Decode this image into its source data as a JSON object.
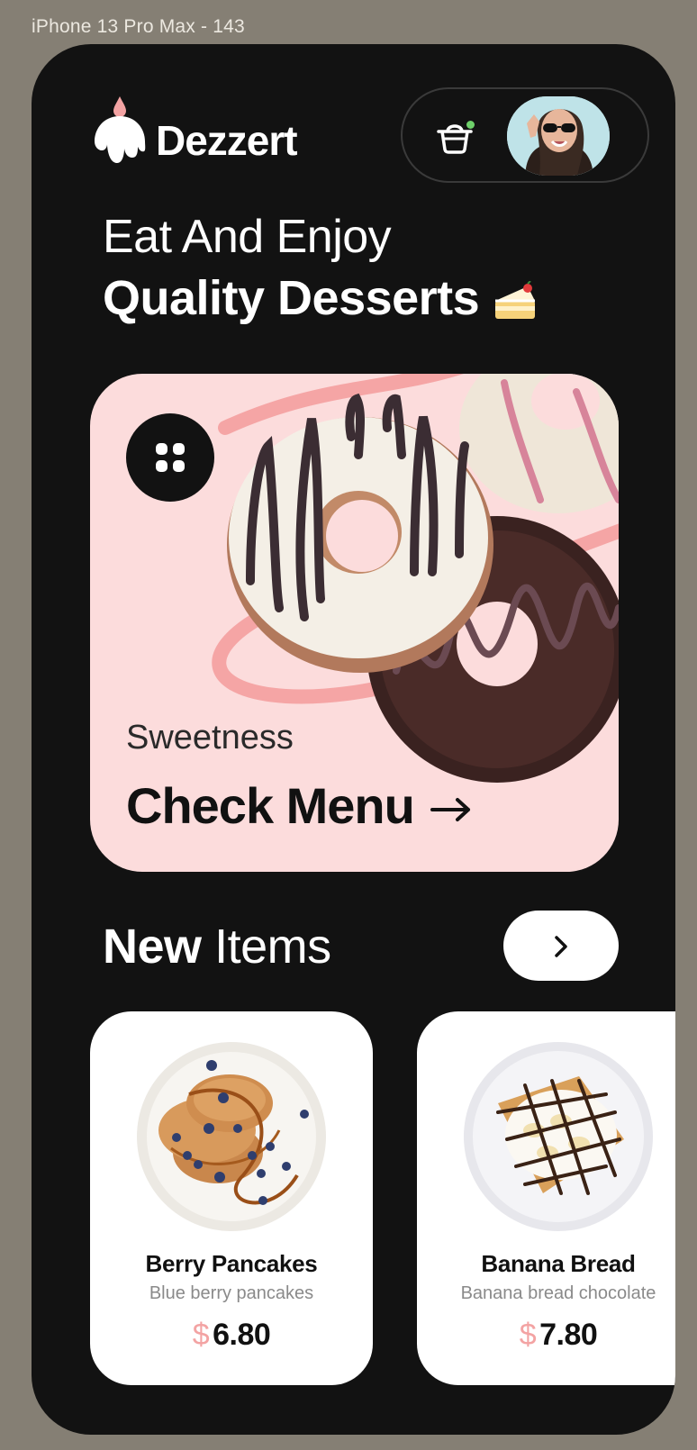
{
  "frame_label": "iPhone 13 Pro Max - 143",
  "brand": {
    "name": "Dezzert"
  },
  "header": {
    "cart_icon": "basket-icon",
    "cart_badge_color": "#6ed06a"
  },
  "hero": {
    "line1": "Eat And Enjoy",
    "line2": "Quality Desserts",
    "emoji_icon": "cake-slice-icon"
  },
  "promo": {
    "subtitle": "Sweetness",
    "title": "Check Menu",
    "arrow_icon": "arrow-right-icon",
    "menu_icon": "grid-dots-icon",
    "background": "#fcdcdc"
  },
  "new_items": {
    "title_bold": "New",
    "title_light": "Items",
    "next_icon": "chevron-right-icon",
    "items": [
      {
        "name": "Berry Pancakes",
        "description": "Blue berry pancakes",
        "currency": "$",
        "price": "6.80"
      },
      {
        "name": "Banana Bread",
        "description": "Banana bread chocolate",
        "currency": "$",
        "price": "7.80"
      }
    ]
  },
  "colors": {
    "app_bg": "#121212",
    "accent_pink": "#f3a3a3",
    "canvas": "#857f74"
  }
}
